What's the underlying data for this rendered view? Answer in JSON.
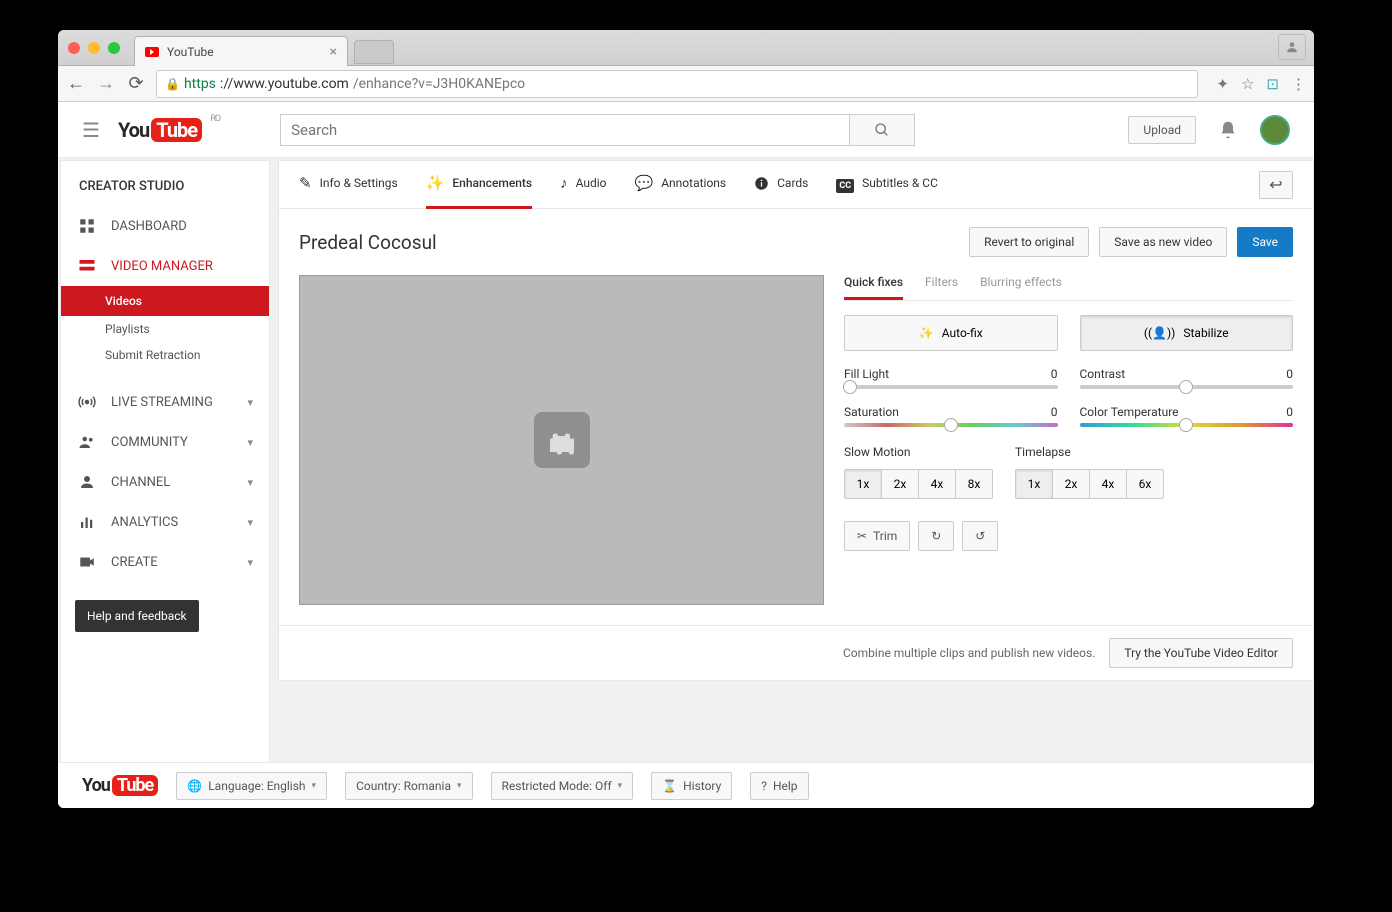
{
  "browser": {
    "tab_title": "YouTube",
    "url_proto": "https",
    "url_host": "://www.youtube.com",
    "url_path": "/enhance?v=J3H0KANEpco"
  },
  "header": {
    "logo_you": "You",
    "logo_tube": "Tube",
    "country_code": "RO",
    "search_placeholder": "Search",
    "upload": "Upload"
  },
  "sidebar": {
    "title": "CREATOR STUDIO",
    "items": [
      {
        "label": "DASHBOARD"
      },
      {
        "label": "VIDEO MANAGER"
      },
      {
        "label": "LIVE STREAMING"
      },
      {
        "label": "COMMUNITY"
      },
      {
        "label": "CHANNEL"
      },
      {
        "label": "ANALYTICS"
      },
      {
        "label": "CREATE"
      }
    ],
    "sub": {
      "videos": "Videos",
      "playlists": "Playlists",
      "retraction": "Submit Retraction"
    },
    "help": "Help and feedback"
  },
  "tabs": {
    "info": "Info & Settings",
    "enhance": "Enhancements",
    "audio": "Audio",
    "annot": "Annotations",
    "cards": "Cards",
    "cc": "Subtitles & CC"
  },
  "title": "Predeal Cocosul",
  "actions": {
    "revert": "Revert to original",
    "saveas": "Save as new video",
    "save": "Save"
  },
  "fixtabs": {
    "quick": "Quick fixes",
    "filters": "Filters",
    "blur": "Blurring effects"
  },
  "auto": {
    "autofix": "Auto-fix",
    "stabilize": "Stabilize"
  },
  "sliders": {
    "fill": {
      "label": "Fill Light",
      "value": "0"
    },
    "contrast": {
      "label": "Contrast",
      "value": "0"
    },
    "sat": {
      "label": "Saturation",
      "value": "0"
    },
    "temp": {
      "label": "Color Temperature",
      "value": "0"
    }
  },
  "speed": {
    "slow_label": "Slow Motion",
    "lapse_label": "Timelapse",
    "slow": [
      "1x",
      "2x",
      "4x",
      "8x"
    ],
    "lapse": [
      "1x",
      "2x",
      "4x",
      "6x"
    ]
  },
  "trim": "Trim",
  "combine": {
    "text": "Combine multiple clips and publish new videos.",
    "btn": "Try the YouTube Video Editor"
  },
  "footer": {
    "lang": "Language: English",
    "country": "Country: Romania",
    "restricted": "Restricted Mode: Off",
    "history": "History",
    "help": "Help"
  }
}
